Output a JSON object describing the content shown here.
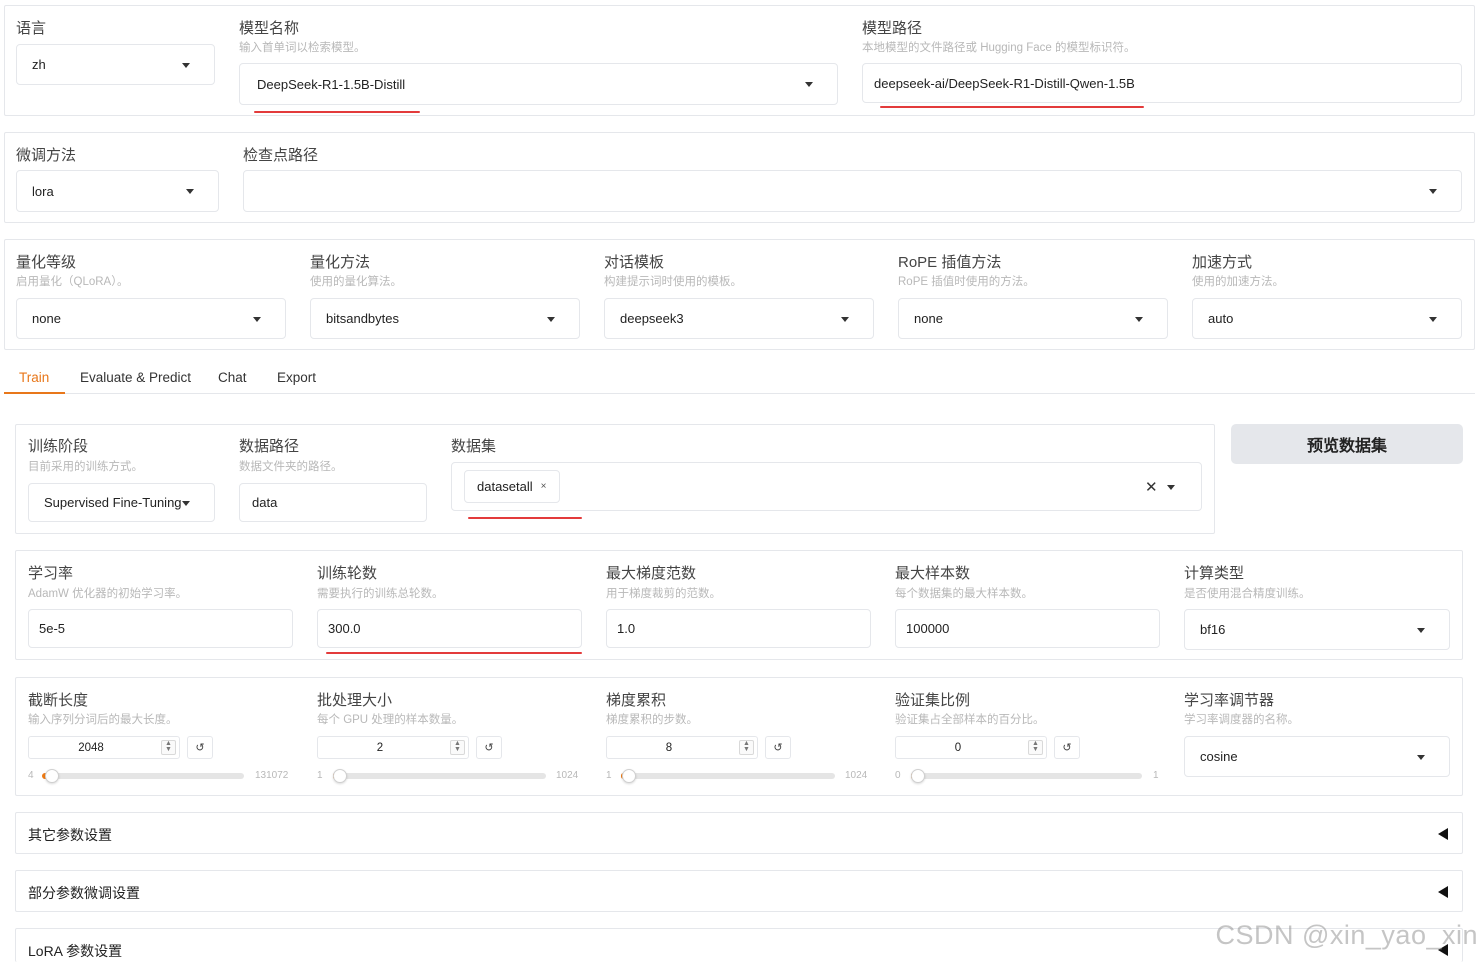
{
  "row1": {
    "language": {
      "label": "语言",
      "value": "zh"
    },
    "model_name": {
      "label": "模型名称",
      "info": "输入首单词以检索模型。",
      "value": "DeepSeek-R1-1.5B-Distill"
    },
    "model_path": {
      "label": "模型路径",
      "info": "本地模型的文件路径或 Hugging Face 的模型标识符。",
      "value": "deepseek-ai/DeepSeek-R1-Distill-Qwen-1.5B"
    }
  },
  "row2": {
    "finetuning": {
      "label": "微调方法",
      "value": "lora"
    },
    "checkpoint": {
      "label": "检查点路径",
      "value": ""
    }
  },
  "row3": {
    "quant_bit": {
      "label": "量化等级",
      "info": "启用量化（QLoRA）。",
      "value": "none"
    },
    "quant_method": {
      "label": "量化方法",
      "info": "使用的量化算法。",
      "value": "bitsandbytes"
    },
    "template": {
      "label": "对话模板",
      "info": "构建提示词时使用的模板。",
      "value": "deepseek3"
    },
    "rope": {
      "label": "RoPE 插值方法",
      "info": "RoPE 插值时使用的方法。",
      "value": "none"
    },
    "booster": {
      "label": "加速方式",
      "info": "使用的加速方法。",
      "value": "auto"
    }
  },
  "tabs": [
    "Train",
    "Evaluate & Predict",
    "Chat",
    "Export"
  ],
  "train": {
    "stage": {
      "label": "训练阶段",
      "info": "目前采用的训练方式。",
      "value": "Supervised Fine-Tuning"
    },
    "dataset_dir": {
      "label": "数据路径",
      "info": "数据文件夹的路径。",
      "value": "data"
    },
    "dataset": {
      "label": "数据集",
      "chip": "datasetall",
      "chip_remove": "×",
      "clear": "✕"
    },
    "preview_button": "预览数据集"
  },
  "params": {
    "learning_rate": {
      "label": "学习率",
      "info": "AdamW 优化器的初始学习率。",
      "value": "5e-5"
    },
    "epochs": {
      "label": "训练轮数",
      "info": "需要执行的训练总轮数。",
      "value": "300.0"
    },
    "max_grad_norm": {
      "label": "最大梯度范数",
      "info": "用于梯度裁剪的范数。",
      "value": "1.0"
    },
    "max_samples": {
      "label": "最大样本数",
      "info": "每个数据集的最大样本数。",
      "value": "100000"
    },
    "compute_type": {
      "label": "计算类型",
      "info": "是否使用混合精度训练。",
      "value": "bf16"
    }
  },
  "sliders": {
    "cutoff_len": {
      "label": "截断长度",
      "info": "输入序列分词后的最大长度。",
      "value": "2048",
      "min": "4",
      "max": "131072",
      "fraction": 0.016
    },
    "batch_size": {
      "label": "批处理大小",
      "info": "每个 GPU 处理的样本数量。",
      "value": "2",
      "min": "1",
      "max": "1024",
      "fraction": 0.001
    },
    "grad_accum": {
      "label": "梯度累积",
      "info": "梯度累积的步数。",
      "value": "8",
      "min": "1",
      "max": "1024",
      "fraction": 0.007
    },
    "val_size": {
      "label": "验证集比例",
      "info": "验证集占全部样本的百分比。",
      "value": "0",
      "min": "0",
      "max": "1",
      "fraction": 0.0
    },
    "lr_scheduler": {
      "label": "学习率调节器",
      "info": "学习率调度器的名称。",
      "value": "cosine"
    }
  },
  "accordions": [
    "其它参数设置",
    "部分参数微调设置",
    "LoRA 参数设置"
  ],
  "watermark": "CSDN @xin_yao_xin",
  "colors": {
    "accent": "#f07b14",
    "annotation": "#e33b3b",
    "border": "#e5e7eb"
  }
}
